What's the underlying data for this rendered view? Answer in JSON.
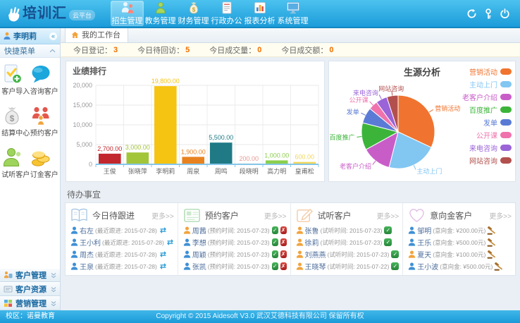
{
  "theme": {
    "header_blue": "#2aa9e0",
    "accent_orange": "#f07000",
    "avatar_blue": "#3d8fd6",
    "avatar_orange": "#f2a33c"
  },
  "header": {
    "logo_text": "培训汇",
    "logo_badge": "云平台",
    "nav": [
      {
        "id": "admissions",
        "label": "招生管理",
        "icon": "students-icon",
        "active": true
      },
      {
        "id": "academic",
        "label": "教务管理",
        "icon": "teacher-icon",
        "active": false
      },
      {
        "id": "finance",
        "label": "财务管理",
        "icon": "moneybag-icon",
        "active": false
      },
      {
        "id": "office",
        "label": "行政办公",
        "icon": "document-icon",
        "active": false
      },
      {
        "id": "report",
        "label": "报表分析",
        "icon": "report-icon",
        "active": false
      },
      {
        "id": "system",
        "label": "系统管理",
        "icon": "monitor-icon",
        "active": false
      }
    ],
    "actions": [
      {
        "id": "refresh",
        "icon": "refresh-icon"
      },
      {
        "id": "password",
        "icon": "key-icon"
      },
      {
        "id": "logout",
        "icon": "power-icon"
      }
    ]
  },
  "sidebar": {
    "user": "李明莉",
    "quick_menu_title": "快捷菜单",
    "quick_items": [
      {
        "id": "customer-import",
        "label": "客户导入",
        "icon": "import-icon"
      },
      {
        "id": "consult-customer",
        "label": "咨询客户",
        "icon": "chat-icon"
      },
      {
        "id": "settlement-center",
        "label": "结算中心",
        "icon": "settlement-icon"
      },
      {
        "id": "appointment-customer",
        "label": "预约客户",
        "icon": "appointment-icon"
      },
      {
        "id": "trial-customer",
        "label": "试听客户",
        "icon": "trial-icon"
      },
      {
        "id": "deposit-customer",
        "label": "订金客户",
        "icon": "coins-icon"
      }
    ],
    "panels": [
      {
        "id": "customer-mgmt",
        "label": "客户管理",
        "icon": "customer-mgmt-icon"
      },
      {
        "id": "customer-res",
        "label": "客户资源",
        "icon": "customer-res-icon"
      },
      {
        "id": "marketing-mgmt",
        "label": "营销管理",
        "icon": "marketing-icon"
      }
    ]
  },
  "tabs": {
    "workbench": "我的工作台"
  },
  "stats": [
    {
      "label": "今日登记：",
      "value": "3"
    },
    {
      "label": "今日待回访：",
      "value": "5"
    },
    {
      "label": "今日成交量：",
      "value": "0"
    },
    {
      "label": "今日成交额：",
      "value": "0"
    }
  ],
  "chart_data": [
    {
      "type": "bar",
      "title": "业绩排行",
      "categories": [
        "王俊",
        "张晓萍",
        "李明莉",
        "周泉",
        "周鸣",
        "段晓明",
        "高力明",
        "皇甫松"
      ],
      "values": [
        2700,
        3000,
        19800,
        1900,
        5500,
        200,
        1000,
        600
      ],
      "value_labels": [
        "2,700.00",
        "3,000.00",
        "19,800.00",
        "1,900.00",
        "5,500.00",
        "200.00",
        "1,000.00",
        "600.00"
      ],
      "colors": [
        "#c1272d",
        "#a3c53a",
        "#f5c312",
        "#e8821e",
        "#1f7a86",
        "#e59a94",
        "#8ccf4d",
        "#f0d75a"
      ],
      "xlabel": "",
      "ylabel": "",
      "ylim": [
        0,
        20000
      ],
      "yticks": [
        "0",
        "5,000",
        "10,000",
        "15,000",
        "20,000"
      ],
      "grid": true,
      "legend_position": "none"
    },
    {
      "type": "pie",
      "title": "生源分析",
      "legend_position": "right",
      "slices": [
        {
          "name": "营销活动",
          "pct": 32,
          "color": "#f0742f"
        },
        {
          "name": "主动上门",
          "pct": 22,
          "color": "#82c6f2"
        },
        {
          "name": "老客户介绍",
          "pct": 13,
          "color": "#c95dc8"
        },
        {
          "name": "百度推广",
          "pct": 12,
          "color": "#3cb43a"
        },
        {
          "name": "发单",
          "pct": 7,
          "color": "#5a7bd5"
        },
        {
          "name": "公开课",
          "pct": 4,
          "color": "#ef72ad"
        },
        {
          "name": "来电咨询",
          "pct": 5,
          "color": "#9a63d8"
        },
        {
          "name": "网站咨询",
          "pct": 5,
          "color": "#b2504e"
        }
      ]
    }
  ],
  "todo": {
    "title": "待办事宜",
    "more_label": "更多>>",
    "columns": [
      {
        "id": "today-followup",
        "title": "今日待跟进",
        "icon": "book-icon",
        "items": [
          {
            "name": "右左",
            "detail": "(最近跟进: 2015-07-28)",
            "avatar": "blue",
            "actions": [
              "transfer"
            ]
          },
          {
            "name": "王小利",
            "detail": "(最近跟进: 2015-07-28)",
            "avatar": "blue",
            "actions": [
              "transfer"
            ]
          },
          {
            "name": "周杰",
            "detail": "(最近跟进: 2015-07-28)",
            "avatar": "blue",
            "actions": [
              "transfer"
            ]
          },
          {
            "name": "王泉",
            "detail": "(最近跟进: 2015-07-28)",
            "avatar": "blue",
            "actions": [
              "transfer"
            ]
          }
        ]
      },
      {
        "id": "appointment",
        "title": "预约客户",
        "icon": "card-icon",
        "items": [
          {
            "name": "周茜",
            "detail": "(预约时间: 2015-07-23)",
            "avatar": "orange",
            "actions": [
              "check",
              "cross"
            ]
          },
          {
            "name": "李想",
            "detail": "(预约时间: 2015-07-23)",
            "avatar": "blue",
            "actions": [
              "check",
              "cross"
            ]
          },
          {
            "name": "周颖",
            "detail": "(预约时间: 2015-07-23)",
            "avatar": "blue",
            "actions": [
              "check",
              "cross"
            ]
          },
          {
            "name": "张凯",
            "detail": "(预约时间: 2015-07-23)",
            "avatar": "blue",
            "actions": [
              "check",
              "cross"
            ]
          }
        ]
      },
      {
        "id": "trial",
        "title": "试听客户",
        "icon": "pencil-icon",
        "items": [
          {
            "name": "张鲁",
            "detail": "(试听时间: 2015-07-23)",
            "avatar": "orange",
            "actions": [
              "check"
            ]
          },
          {
            "name": "徐莉",
            "detail": "(试听时间: 2015-07-23)",
            "avatar": "orange",
            "actions": [
              "check"
            ]
          },
          {
            "name": "刘燕燕",
            "detail": "(试听时间: 2015-07-23)",
            "avatar": "orange",
            "actions": [
              "check"
            ]
          },
          {
            "name": "王晓琴",
            "detail": "(试听时间: 2015-07-22)",
            "avatar": "orange",
            "actions": [
              "check"
            ]
          }
        ]
      },
      {
        "id": "deposit",
        "title": "意向金客户",
        "icon": "heart-icon",
        "items": [
          {
            "name": "邹明",
            "detail": "(意向金: ¥200.00元)",
            "avatar": "blue",
            "actions": [
              "gavel"
            ]
          },
          {
            "name": "王乐",
            "detail": "(意向金: ¥500.00元)",
            "avatar": "blue",
            "actions": [
              "gavel"
            ]
          },
          {
            "name": "夏天",
            "detail": "(意向金: ¥100.00元)",
            "avatar": "orange",
            "actions": [
              "gavel"
            ]
          },
          {
            "name": "王小波",
            "detail": "(意向金: ¥500.00元)",
            "avatar": "blue",
            "actions": [
              "gavel"
            ]
          }
        ]
      }
    ]
  },
  "footer": {
    "campus": "校区：诺曼教育",
    "copyright": "Copyright © 2015 Aidesoft V3.0 武汉艾德科技有限公司 保留所有权"
  }
}
